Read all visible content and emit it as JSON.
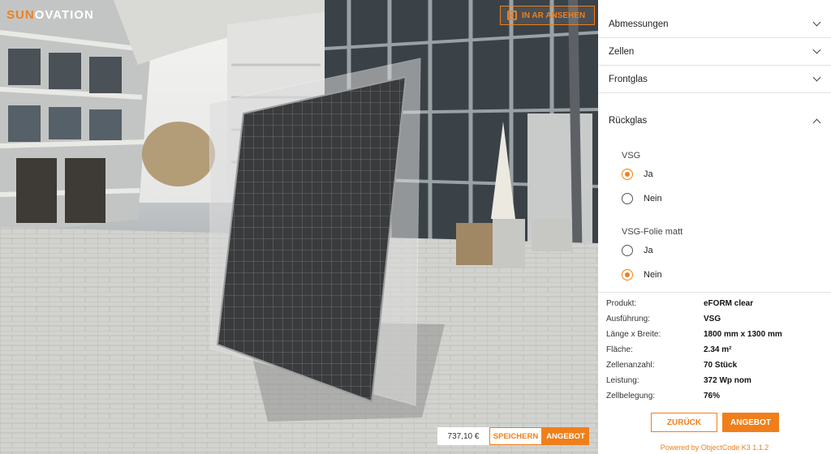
{
  "brand": {
    "part1": "SUN",
    "part2": "OVATION",
    "accent": "#f07f1b"
  },
  "viewer": {
    "ar_button": {
      "label": "IN AR ANSEHEN",
      "icon": "ar-cube-icon"
    },
    "price": "737,10 €",
    "save_label": "SPEICHERN",
    "offer_label": "ANGEBOT"
  },
  "panel": {
    "accordions": [
      {
        "label": "Abmessungen",
        "expanded": false
      },
      {
        "label": "Zellen",
        "expanded": false
      },
      {
        "label": "Frontglas",
        "expanded": false
      },
      {
        "label": "Rückglas",
        "expanded": true
      }
    ],
    "groups": [
      {
        "title": "VSG",
        "options": [
          {
            "label": "Ja",
            "checked": true
          },
          {
            "label": "Nein",
            "checked": false
          }
        ]
      },
      {
        "title": "VSG-Folie matt",
        "options": [
          {
            "label": "Ja",
            "checked": false
          },
          {
            "label": "Nein",
            "checked": true
          }
        ]
      }
    ],
    "summary": [
      {
        "label": "Produkt:",
        "value": "eFORM clear"
      },
      {
        "label": "Ausführung:",
        "value": "VSG"
      },
      {
        "label": "Länge x Breite:",
        "value": "1800 mm x 1300 mm"
      },
      {
        "label": "Fläche:",
        "value": "2.34 m²"
      },
      {
        "label": "Zellenanzahl:",
        "value": "70 Stück"
      },
      {
        "label": "Leistung:",
        "value": "372 Wp nom"
      },
      {
        "label": "Zellbelegung:",
        "value": "76%"
      }
    ],
    "back_label": "ZURÜCK",
    "offer_label": "ANGEBOT",
    "powered_by": "Powered by ObjectCode K3 1.1.2"
  }
}
